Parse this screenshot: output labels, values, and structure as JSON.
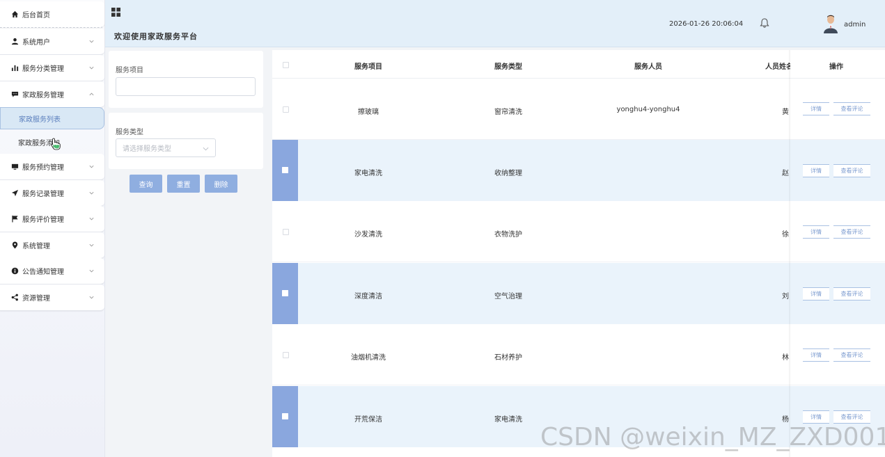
{
  "sidebar": {
    "items": [
      {
        "label": "后台首页",
        "icon": "home-icon",
        "expandable": false
      },
      {
        "label": "系统用户",
        "icon": "user-icon",
        "expandable": true
      },
      {
        "label": "服务分类管理",
        "icon": "bar-chart-icon",
        "expandable": true
      },
      {
        "label": "家政服务管理",
        "icon": "comment-icon",
        "expandable": true,
        "expanded": true
      },
      {
        "label": "服务预约管理",
        "icon": "monitor-icon",
        "expandable": true
      },
      {
        "label": "服务记录管理",
        "icon": "send-icon",
        "expandable": true
      },
      {
        "label": "服务评价管理",
        "icon": "flag-icon",
        "expandable": true
      },
      {
        "label": "系统管理",
        "icon": "location-pin-icon",
        "expandable": true
      },
      {
        "label": "公告通知管理",
        "icon": "info-icon",
        "expandable": true
      },
      {
        "label": "资源管理",
        "icon": "share-icon",
        "expandable": true
      }
    ],
    "sub_items": [
      {
        "label": "家政服务列表",
        "active": true
      },
      {
        "label": "家政服务添加",
        "active": false
      }
    ]
  },
  "header": {
    "title": "欢迎使用家政服务平台",
    "datetime": "2026-01-26 20:06:04",
    "username": "admin"
  },
  "search": {
    "service_item_label": "服务项目",
    "service_item_value": "",
    "service_type_label": "服务类型",
    "service_type_placeholder": "请选择服务类型",
    "query_button": "查询",
    "reset_button": "重置",
    "delete_button": "删除"
  },
  "table": {
    "columns": [
      "服务项目",
      "服务类型",
      "服务人员",
      "人员姓名",
      "操作"
    ],
    "detail_label": "详情",
    "review_label": "查看评论",
    "rows": [
      {
        "item": "擦玻璃",
        "type": "窗帘清洗",
        "staff": "yonghu4-yonghu4",
        "name": "黄",
        "selected": false
      },
      {
        "item": "家电清洗",
        "type": "收纳整理",
        "staff": "",
        "name": "赵",
        "selected": true
      },
      {
        "item": "沙发清洗",
        "type": "衣物洗护",
        "staff": "",
        "name": "徐",
        "selected": false
      },
      {
        "item": "深度清洁",
        "type": "空气治理",
        "staff": "",
        "name": "刘",
        "selected": true
      },
      {
        "item": "油烟机清洗",
        "type": "石材养护",
        "staff": "",
        "name": "林",
        "selected": false
      },
      {
        "item": "开荒保洁",
        "type": "家电清洗",
        "staff": "",
        "name": "杨",
        "selected": true
      }
    ]
  },
  "watermark": "CSDN @weixin_MZ_ZXD001",
  "colors": {
    "accent": "#8faee0",
    "selected_bar": "#8aa7de",
    "header_bg": "#e3eff9",
    "row_alt": "#eaf3fb",
    "active_sub": "#d9e8f5"
  }
}
